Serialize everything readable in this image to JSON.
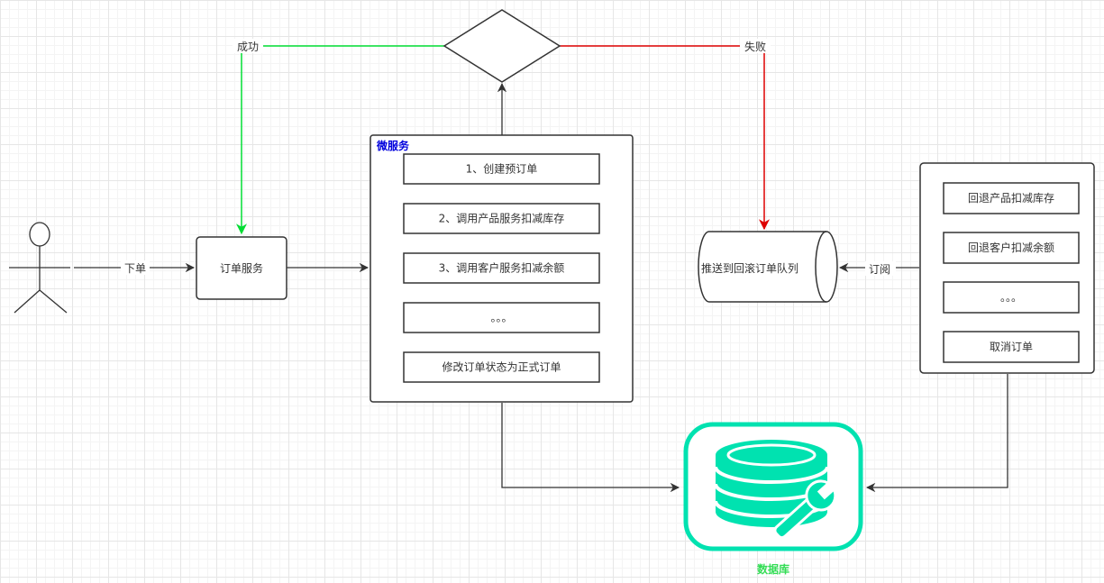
{
  "actor": {
    "edge_label": "下单"
  },
  "order_service": {
    "label": "订单服务"
  },
  "microservice": {
    "title": "微服务",
    "steps": [
      "1、创建预订单",
      "2、调用产品服务扣减库存",
      "3、调用客户服务扣减余额",
      "。。。",
      "修改订单状态为正式订单"
    ]
  },
  "decision": {
    "success_label": "成功",
    "failure_label": "失败"
  },
  "queue": {
    "label": "推送到回滚订单队列"
  },
  "rollback": {
    "subscribe_label": "订阅",
    "steps": [
      "回退产品扣减库存",
      "回退客户扣减余额",
      "。。。",
      "取消订单"
    ]
  },
  "database": {
    "label": "数据库"
  },
  "colors": {
    "success": "#00dd33",
    "failure": "#dd0000",
    "edge": "#333333",
    "container_title": "#0000dd",
    "database": "#00e2b0",
    "database_label": "#33dd55"
  }
}
